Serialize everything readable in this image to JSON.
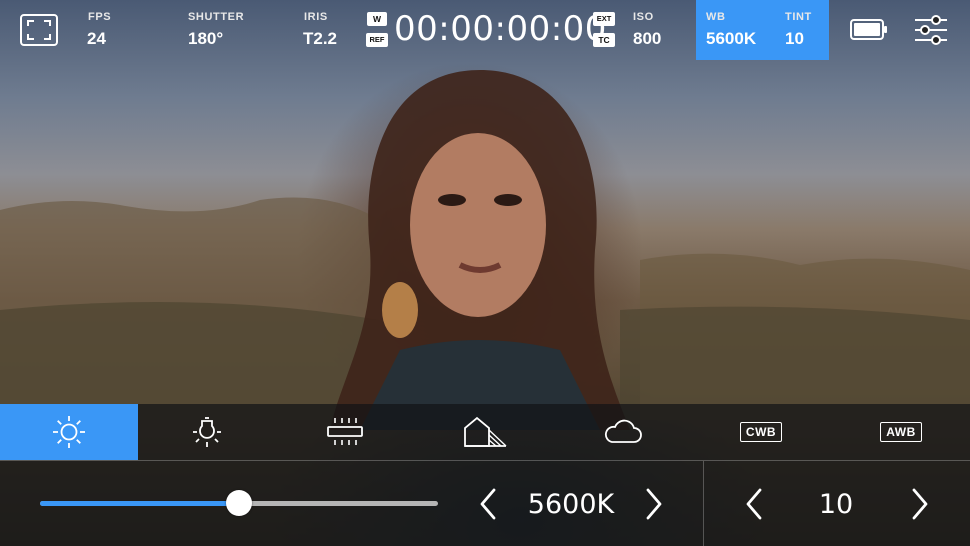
{
  "top": {
    "fps": {
      "label": "FPS",
      "value": "24"
    },
    "shutter": {
      "label": "SHUTTER",
      "value": "180°"
    },
    "iris": {
      "label": "IRIS",
      "value": "T2.2"
    },
    "w_tag": "W",
    "ref_tag": "REF",
    "timecode": "00:00:00:00",
    "ext_tag": "EXT",
    "tc_tag": "TC",
    "iso": {
      "label": "ISO",
      "value": "800"
    },
    "wb": {
      "label": "WB",
      "value": "5600K"
    },
    "tint": {
      "label": "TINT",
      "value": "10"
    }
  },
  "presets": {
    "cwb_label": "CWB",
    "awb_label": "AWB",
    "active": "daylight"
  },
  "controls": {
    "wb_value": "5600K",
    "wb_slider_fraction": 0.5,
    "tint_value": "10"
  },
  "colors": {
    "accent": "#3a97f6"
  }
}
